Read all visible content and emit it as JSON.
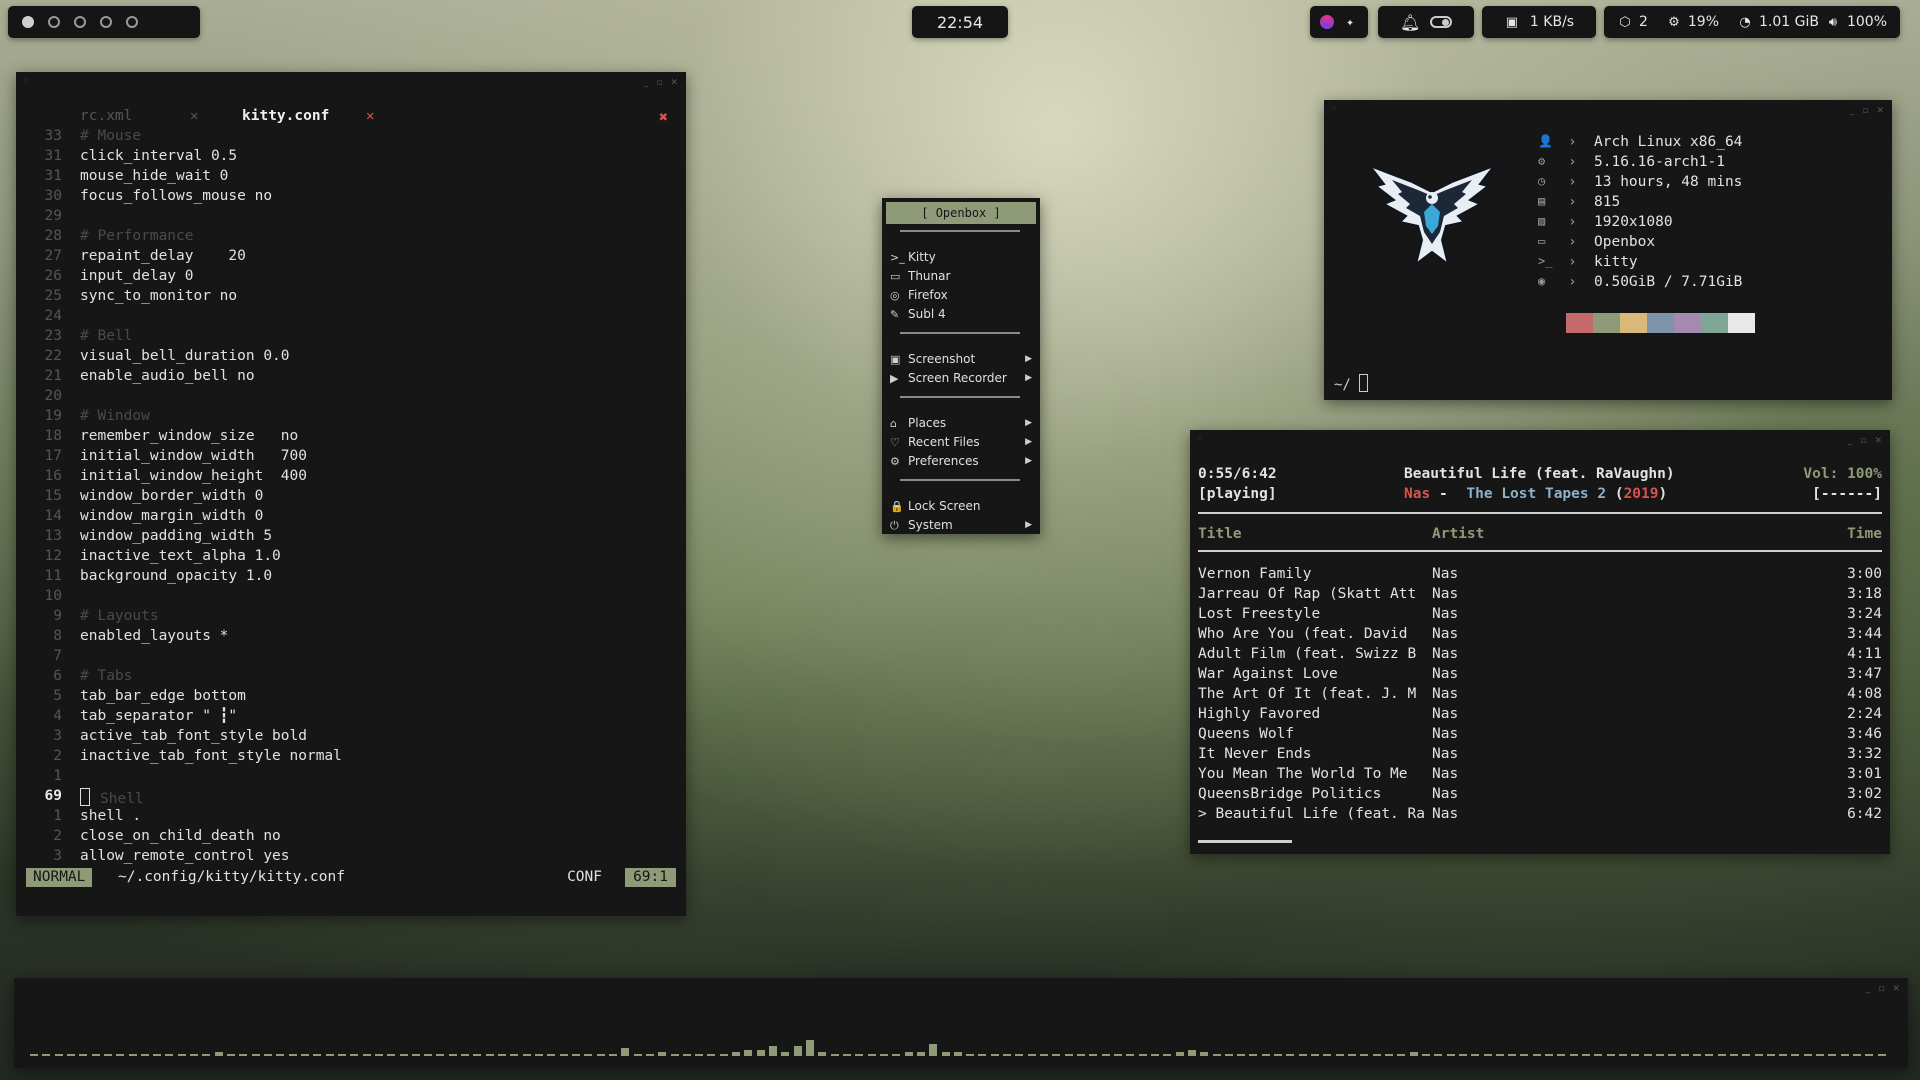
{
  "topbar": {
    "workspaces": [
      {
        "active": true
      },
      {
        "active": false
      },
      {
        "active": false
      },
      {
        "active": false
      },
      {
        "active": false
      }
    ],
    "clock": "22:54",
    "net_speed": "1 KB/s",
    "updates": "2",
    "cpu": "19%",
    "memory": "1.01 GiB",
    "volume": "100%"
  },
  "editor": {
    "tabs": [
      {
        "name": "rc.xml",
        "active": false
      },
      {
        "name": "kitty.conf",
        "active": true
      }
    ],
    "lines": [
      {
        "n": "33",
        "text": "# Mouse",
        "comment": true
      },
      {
        "n": "31",
        "text": "click_interval 0.5"
      },
      {
        "n": "31",
        "text": "mouse_hide_wait 0"
      },
      {
        "n": "30",
        "text": "focus_follows_mouse no"
      },
      {
        "n": "29",
        "text": ""
      },
      {
        "n": "28",
        "text": "# Performance",
        "comment": true
      },
      {
        "n": "27",
        "text": "repaint_delay    20"
      },
      {
        "n": "26",
        "text": "input_delay 0"
      },
      {
        "n": "25",
        "text": "sync_to_monitor no"
      },
      {
        "n": "24",
        "text": ""
      },
      {
        "n": "23",
        "text": "# Bell",
        "comment": true
      },
      {
        "n": "22",
        "text": "visual_bell_duration 0.0"
      },
      {
        "n": "21",
        "text": "enable_audio_bell no"
      },
      {
        "n": "20",
        "text": ""
      },
      {
        "n": "19",
        "text": "# Window",
        "comment": true
      },
      {
        "n": "18",
        "text": "remember_window_size   no"
      },
      {
        "n": "17",
        "text": "initial_window_width   700"
      },
      {
        "n": "16",
        "text": "initial_window_height  400"
      },
      {
        "n": "15",
        "text": "window_border_width 0"
      },
      {
        "n": "14",
        "text": "window_margin_width 0"
      },
      {
        "n": "13",
        "text": "window_padding_width 5"
      },
      {
        "n": "12",
        "text": "inactive_text_alpha 1.0"
      },
      {
        "n": "11",
        "text": "background_opacity 1.0"
      },
      {
        "n": "10",
        "text": ""
      },
      {
        "n": "9",
        "text": "# Layouts",
        "comment": true
      },
      {
        "n": "8",
        "text": "enabled_layouts *"
      },
      {
        "n": "7",
        "text": ""
      },
      {
        "n": "6",
        "text": "# Tabs",
        "comment": true
      },
      {
        "n": "5",
        "text": "tab_bar_edge bottom"
      },
      {
        "n": "4",
        "text": "tab_separator \" ┇\""
      },
      {
        "n": "3",
        "text": "active_tab_font_style bold"
      },
      {
        "n": "2",
        "text": "inactive_tab_font_style normal"
      },
      {
        "n": "1",
        "text": ""
      },
      {
        "n": "69",
        "text": "Shell",
        "comment": true,
        "current": true
      },
      {
        "n": "1",
        "text": "shell ."
      },
      {
        "n": "2",
        "text": "close_on_child_death no"
      },
      {
        "n": "3",
        "text": "allow_remote_control yes"
      }
    ],
    "status": {
      "mode": "NORMAL",
      "path": "~/.config/kitty/kitty.conf",
      "filetype": "CONF",
      "position": "69:1"
    }
  },
  "menu": {
    "title": "[ Openbox ]",
    "groups": [
      [
        {
          "icon": ">_",
          "label": "Kitty",
          "submenu": false
        },
        {
          "icon": "▭",
          "label": "Thunar",
          "submenu": false
        },
        {
          "icon": "◎",
          "label": "Firefox",
          "submenu": false
        },
        {
          "icon": "✎",
          "label": "Subl 4",
          "submenu": false
        }
      ],
      [
        {
          "icon": "▣",
          "label": "Screenshot",
          "submenu": true
        },
        {
          "icon": "▶",
          "label": "Screen Recorder",
          "submenu": true
        }
      ],
      [
        {
          "icon": "⌂",
          "label": "Places",
          "submenu": true
        },
        {
          "icon": "♡",
          "label": "Recent Files",
          "submenu": true
        },
        {
          "icon": "⚙",
          "label": "Preferences",
          "submenu": true
        }
      ],
      [
        {
          "icon": "🔒",
          "label": "Lock Screen",
          "submenu": false
        },
        {
          "icon": "⏻",
          "label": "System",
          "submenu": true
        }
      ]
    ]
  },
  "fetch": {
    "rows": [
      {
        "icon": "👤",
        "value": "Arch Linux x86_64"
      },
      {
        "icon": "⚙",
        "value": "5.16.16-arch1-1"
      },
      {
        "icon": "◷",
        "value": "13 hours, 48 mins"
      },
      {
        "icon": "▤",
        "value": "815"
      },
      {
        "icon": "▨",
        "value": "1920x1080"
      },
      {
        "icon": "▭",
        "value": "Openbox"
      },
      {
        "icon": ">_",
        "value": "kitty"
      },
      {
        "icon": "◉",
        "value": "0.50GiB / 7.71GiB"
      }
    ],
    "palette": [
      "#c56b6b",
      "#8f9a78",
      "#d9b87a",
      "#7e93ab",
      "#a58ab0",
      "#7fa595",
      "#e8e8e8"
    ],
    "prompt": "~/"
  },
  "music": {
    "time": "0:55/6:42",
    "state": "[playing]",
    "song": "Beautiful Life (feat. RaVaughn)",
    "artist": "Nas",
    "sep": "-",
    "album": "The Lost Tapes 2",
    "year": "2019",
    "volume": "Vol: 100%",
    "flags": "[------]",
    "headers": {
      "title": "Title",
      "artist": "Artist",
      "time": "Time"
    },
    "tracks": [
      {
        "title": "Vernon Family",
        "artist": "Nas",
        "time": "3:00"
      },
      {
        "title": "Jarreau Of Rap (Skatt Att",
        "artist": "Nas",
        "time": "3:18"
      },
      {
        "title": "Lost Freestyle",
        "artist": "Nas",
        "time": "3:24"
      },
      {
        "title": "Who Are You (feat. David",
        "artist": "Nas",
        "time": "3:44"
      },
      {
        "title": "Adult Film (feat. Swizz B",
        "artist": "Nas",
        "time": "4:11"
      },
      {
        "title": "War Against Love",
        "artist": "Nas",
        "time": "3:47"
      },
      {
        "title": "The Art Of It (feat. J. M",
        "artist": "Nas",
        "time": "4:08"
      },
      {
        "title": "Highly Favored",
        "artist": "Nas",
        "time": "2:24"
      },
      {
        "title": "Queens Wolf",
        "artist": "Nas",
        "time": "3:46"
      },
      {
        "title": "It Never Ends",
        "artist": "Nas",
        "time": "3:32"
      },
      {
        "title": "You Mean The World To Me",
        "artist": "Nas",
        "time": "3:01"
      },
      {
        "title": "QueensBridge Politics",
        "artist": "Nas",
        "time": "3:02"
      },
      {
        "title": "> Beautiful Life (feat. Ra",
        "artist": "Nas",
        "time": "6:42"
      }
    ],
    "progress": 0.137
  },
  "visualizer": {
    "levels": [
      1,
      1,
      1,
      1,
      1,
      1,
      1,
      1,
      1,
      1,
      1,
      1,
      1,
      1,
      1,
      2,
      1,
      1,
      1,
      1,
      1,
      1,
      1,
      1,
      1,
      1,
      1,
      1,
      1,
      1,
      1,
      1,
      1,
      1,
      1,
      1,
      1,
      1,
      1,
      1,
      1,
      1,
      1,
      1,
      1,
      1,
      1,
      1,
      4,
      1,
      1,
      2,
      1,
      1,
      1,
      1,
      1,
      2,
      3,
      3,
      5,
      2,
      5,
      8,
      2,
      1,
      1,
      1,
      1,
      1,
      1,
      2,
      2,
      6,
      2,
      2,
      1,
      1,
      1,
      1,
      1,
      1,
      1,
      1,
      1,
      1,
      1,
      1,
      1,
      1,
      1,
      1,
      1,
      2,
      3,
      2,
      1,
      1,
      1,
      1,
      1,
      1,
      1,
      1,
      1,
      1,
      1,
      1,
      1,
      1,
      1,
      1,
      2,
      1,
      1,
      1,
      1,
      1,
      1,
      1,
      1,
      1,
      1,
      1,
      1,
      1,
      1,
      1,
      1,
      1,
      1,
      1,
      1,
      1,
      1,
      1,
      1,
      1,
      1,
      1,
      1,
      1,
      1,
      1,
      1,
      1,
      1,
      1,
      1,
      1,
      1
    ]
  },
  "colors": {
    "accent": "#8f9a78",
    "red": "#d9534f"
  }
}
